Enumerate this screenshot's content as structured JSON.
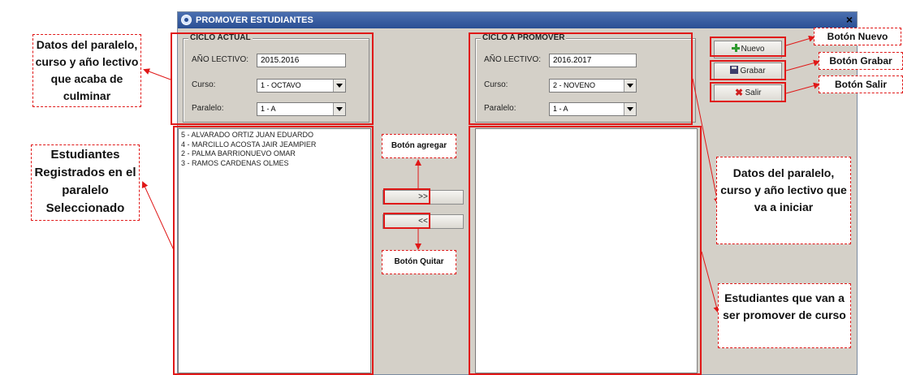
{
  "window": {
    "title": "PROMOVER ESTUDIANTES",
    "close_glyph": "×"
  },
  "ciclo_actual": {
    "legend": "CICLO ACTUAL",
    "anio_label": "AÑO LECTIVO:",
    "anio_value": "2015.2016",
    "curso_label": "Curso:",
    "curso_value": "1 - OCTAVO",
    "paralelo_label": "Paralelo:",
    "paralelo_value": "1 - A"
  },
  "ciclo_promover": {
    "legend": "CICLO A PROMOVER",
    "anio_label": "AÑO LECTIVO:",
    "anio_value": "2016.2017",
    "curso_label": "Curso:",
    "curso_value": "2 - NOVENO",
    "paralelo_label": "Paralelo:",
    "paralelo_value": "1 - A"
  },
  "students": [
    "5 - ALVARADO ORTIZ JUAN EDUARDO",
    "4 - MARCILLO ACOSTA JAIR JEAMPIER",
    "2 - PALMA BARRIONUEVO OMAR",
    "3 - RAMOS CARDENAS OLMES"
  ],
  "promoted_students": [],
  "transfer": {
    "add_label": ">>",
    "remove_label": "<<"
  },
  "actions": {
    "nuevo": "Nuevo",
    "grabar": "Grabar",
    "salir": "Salir"
  },
  "annotations": {
    "datos_actual": "Datos del paralelo, curso y año lectivo que acaba de culminar",
    "estudiantes_registrados": "Estudiantes Registrados en el paralelo Seleccionado",
    "boton_agregar": "Botón agregar",
    "boton_quitar": "Botón Quitar",
    "datos_promover": "Datos del paralelo, curso y año lectivo que va a iniciar",
    "estudiantes_promover": "Estudiantes que van a ser promover de curso",
    "boton_nuevo": "Botón Nuevo",
    "boton_grabar": "Botón Grabar",
    "boton_salir": "Botón Salir"
  },
  "colors": {
    "annotation_red": "#e01818",
    "window_bg": "#d4d0c8",
    "titlebar": "#2a4f94"
  }
}
